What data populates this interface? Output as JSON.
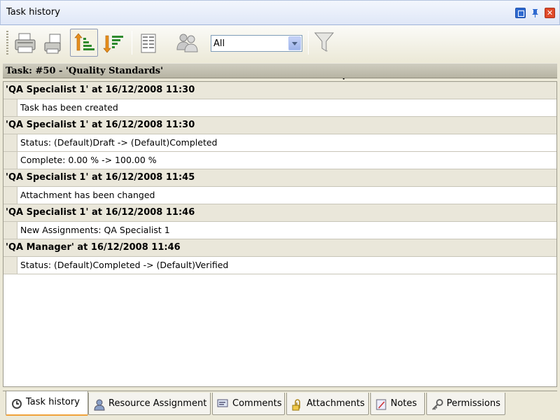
{
  "window": {
    "title": "Task history"
  },
  "toolbar": {
    "filter_value": "All"
  },
  "task": {
    "header": "Task: #50 - 'Quality Standards'"
  },
  "history": [
    {
      "header": "'QA Specialist 1' at 16/12/2008 11:30",
      "items": [
        "Task has been created"
      ]
    },
    {
      "header": "'QA Specialist 1' at 16/12/2008 11:30",
      "items": [
        "Status: (Default)Draft -> (Default)Completed",
        "Complete: 0.00 % -> 100.00 %"
      ]
    },
    {
      "header": "'QA Specialist 1' at 16/12/2008 11:45",
      "items": [
        "Attachment has been changed"
      ]
    },
    {
      "header": "'QA Specialist 1' at 16/12/2008 11:46",
      "items": [
        "New Assignments: QA Specialist 1"
      ]
    },
    {
      "header": "'QA Manager' at 16/12/2008 11:46",
      "items": [
        "Status: (Default)Completed -> (Default)Verified"
      ]
    }
  ],
  "tabs": [
    {
      "label": "Task history",
      "icon": "clock-icon",
      "active": true
    },
    {
      "label": "Resource Assignment",
      "icon": "user-icon",
      "active": false
    },
    {
      "label": "Comments",
      "icon": "comments-icon",
      "active": false
    },
    {
      "label": "Attachments",
      "icon": "paperclip-icon",
      "active": false
    },
    {
      "label": "Notes",
      "icon": "notes-icon",
      "active": false
    },
    {
      "label": "Permissions",
      "icon": "key-icon",
      "active": false
    }
  ],
  "colors": {
    "accent_tab": "#f0a23a",
    "close_button": "#e04b2a",
    "restore_button": "#2f6ad0"
  }
}
